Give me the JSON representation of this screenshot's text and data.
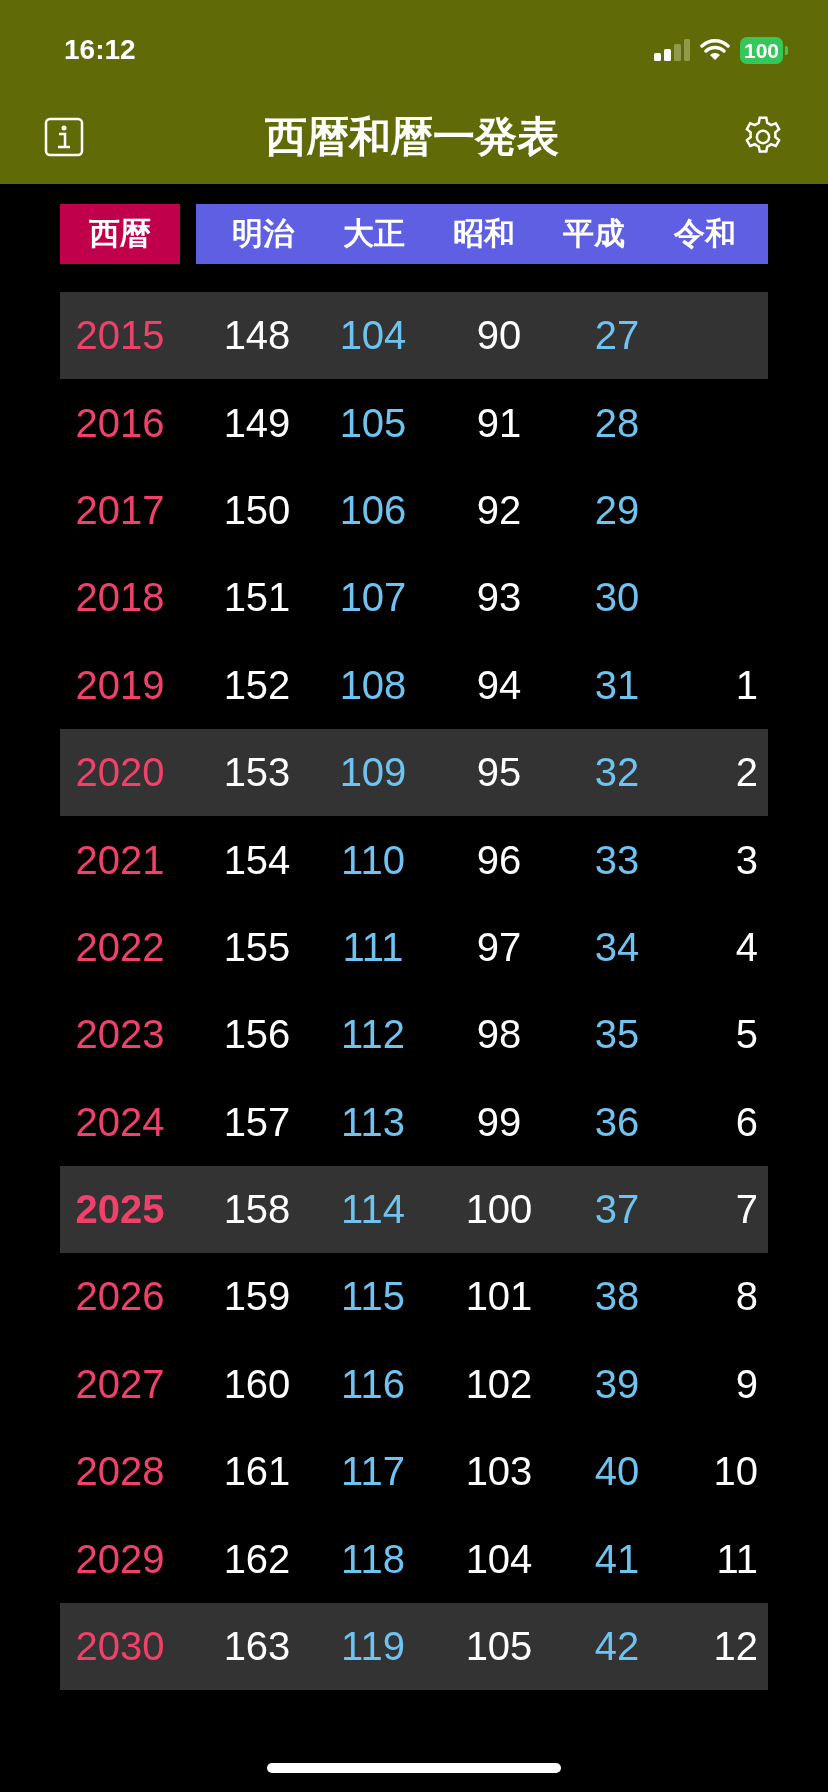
{
  "status_bar": {
    "time": "16:12",
    "battery": "100"
  },
  "nav": {
    "title": "西暦和暦一発表"
  },
  "columns": [
    {
      "label": "西暦",
      "kind": "western"
    },
    {
      "label": "明治",
      "kind": "era"
    },
    {
      "label": "大正",
      "kind": "era"
    },
    {
      "label": "昭和",
      "kind": "era"
    },
    {
      "label": "平成",
      "kind": "era"
    },
    {
      "label": "令和",
      "kind": "era"
    }
  ],
  "rows": [
    {
      "year": "2015",
      "eras": [
        "148",
        "104",
        "90",
        "27"
      ],
      "highlighted": true,
      "current": false
    },
    {
      "year": "2016",
      "eras": [
        "149",
        "105",
        "91",
        "28"
      ],
      "highlighted": false,
      "current": false
    },
    {
      "year": "2017",
      "eras": [
        "150",
        "106",
        "92",
        "29"
      ],
      "highlighted": false,
      "current": false
    },
    {
      "year": "2018",
      "eras": [
        "151",
        "107",
        "93",
        "30"
      ],
      "highlighted": false,
      "current": false
    },
    {
      "year": "2019",
      "eras": [
        "152",
        "108",
        "94",
        "31",
        "1"
      ],
      "highlighted": false,
      "current": false
    },
    {
      "year": "2020",
      "eras": [
        "153",
        "109",
        "95",
        "32",
        "2"
      ],
      "highlighted": true,
      "current": false
    },
    {
      "year": "2021",
      "eras": [
        "154",
        "110",
        "96",
        "33",
        "3"
      ],
      "highlighted": false,
      "current": false
    },
    {
      "year": "2022",
      "eras": [
        "155",
        "111",
        "97",
        "34",
        "4"
      ],
      "highlighted": false,
      "current": false
    },
    {
      "year": "2023",
      "eras": [
        "156",
        "112",
        "98",
        "35",
        "5"
      ],
      "highlighted": false,
      "current": false
    },
    {
      "year": "2024",
      "eras": [
        "157",
        "113",
        "99",
        "36",
        "6"
      ],
      "highlighted": false,
      "current": false
    },
    {
      "year": "2025",
      "eras": [
        "158",
        "114",
        "100",
        "37",
        "7"
      ],
      "highlighted": true,
      "current": true
    },
    {
      "year": "2026",
      "eras": [
        "159",
        "115",
        "101",
        "38",
        "8"
      ],
      "highlighted": false,
      "current": false
    },
    {
      "year": "2027",
      "eras": [
        "160",
        "116",
        "102",
        "39",
        "9"
      ],
      "highlighted": false,
      "current": false
    },
    {
      "year": "2028",
      "eras": [
        "161",
        "117",
        "103",
        "40",
        "10"
      ],
      "highlighted": false,
      "current": false
    },
    {
      "year": "2029",
      "eras": [
        "162",
        "118",
        "104",
        "41",
        "11"
      ],
      "highlighted": false,
      "current": false
    },
    {
      "year": "2030",
      "eras": [
        "163",
        "119",
        "105",
        "42",
        "12"
      ],
      "highlighted": true,
      "current": false
    }
  ]
}
